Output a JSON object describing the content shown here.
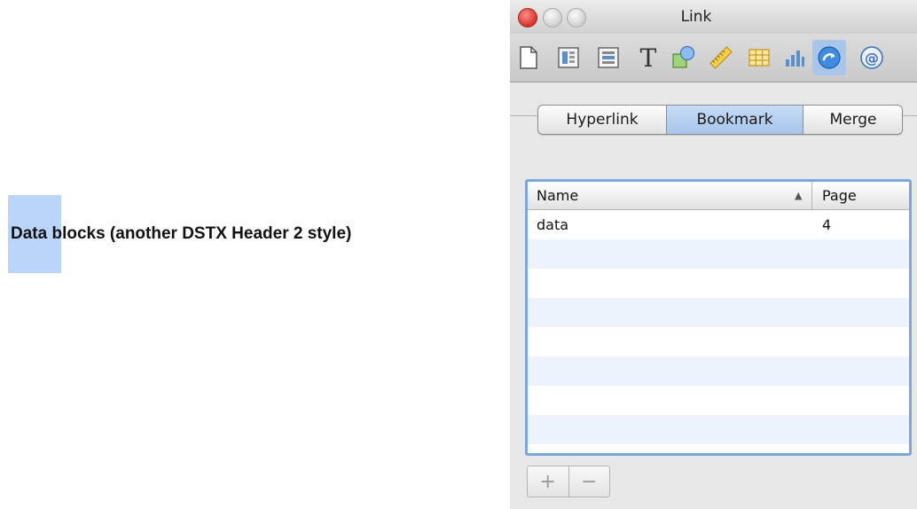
{
  "document": {
    "heading_selected": "Data",
    "heading_rest": " blocks (another DSTX Header 2 style)"
  },
  "window": {
    "title": "Link"
  },
  "toolbar": {
    "icons": [
      "document-icon",
      "layout-icon",
      "wrap-icon",
      "text-icon",
      "shapes-icon",
      "ruler-icon",
      "table-icon",
      "chart-icon",
      "link-icon",
      "citation-icon"
    ],
    "active_icon": "link-icon"
  },
  "segments": {
    "hyperlink": "Hyperlink",
    "bookmark": "Bookmark",
    "merge": "Merge",
    "selected": "Bookmark"
  },
  "bookmarks_table": {
    "col_name": "Name",
    "col_page": "Page",
    "sort_indicator": "▲",
    "rows": [
      {
        "name": "data",
        "page": "4"
      }
    ]
  },
  "buttons": {
    "add": "+",
    "remove": "−"
  },
  "colors": {
    "selection": "#b9d5fb",
    "table_focus": "#7ba6de",
    "segment_selected": "#a7c5ea"
  }
}
